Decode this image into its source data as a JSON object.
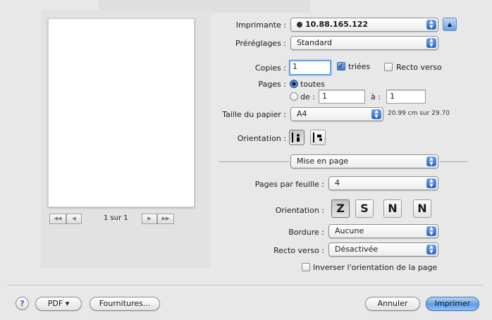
{
  "printer": {
    "label": "Imprimante :",
    "value": "10.88.165.122",
    "status_icon": "info-dot-icon"
  },
  "presets": {
    "label": "Préréglages :",
    "value": "Standard"
  },
  "copies": {
    "label": "Copies :",
    "value": "1",
    "collated_label": "triées",
    "collated": true,
    "duplex_label": "Recto verso",
    "duplex": false
  },
  "pages": {
    "label": "Pages :",
    "all_label": "toutes",
    "from_label": "de :",
    "from_value": "1",
    "to_label": "à :",
    "to_value": "1",
    "selected": "all"
  },
  "paper": {
    "label": "Taille du papier :",
    "value": "A4",
    "dimensions": "20.99 cm sur 29.70"
  },
  "orientation": {
    "label": "Orientation :",
    "selected": "portrait"
  },
  "section": {
    "value": "Mise en page"
  },
  "layout": {
    "pages_per_sheet_label": "Pages par feuille :",
    "pages_per_sheet": "4",
    "direction_label": "Orientation :",
    "directions": [
      "Z",
      "S",
      "N",
      "N"
    ],
    "border_label": "Bordure :",
    "border": "Aucune",
    "duplex_label": "Recto verso :",
    "duplex": "Désactivée",
    "reverse_label": "Inverser l'orientation de la page",
    "reverse": false
  },
  "preview": {
    "page_counter": "1 sur 1",
    "first": "◀◀",
    "prev": "◀",
    "next": "▶",
    "last": "▶▶"
  },
  "footer": {
    "help": "?",
    "pdf": "PDF ▾",
    "supplies": "Fournitures...",
    "cancel": "Annuler",
    "print": "Imprimer"
  },
  "colors": {
    "accent": "#3677d6",
    "window": "#e8e8e8"
  }
}
